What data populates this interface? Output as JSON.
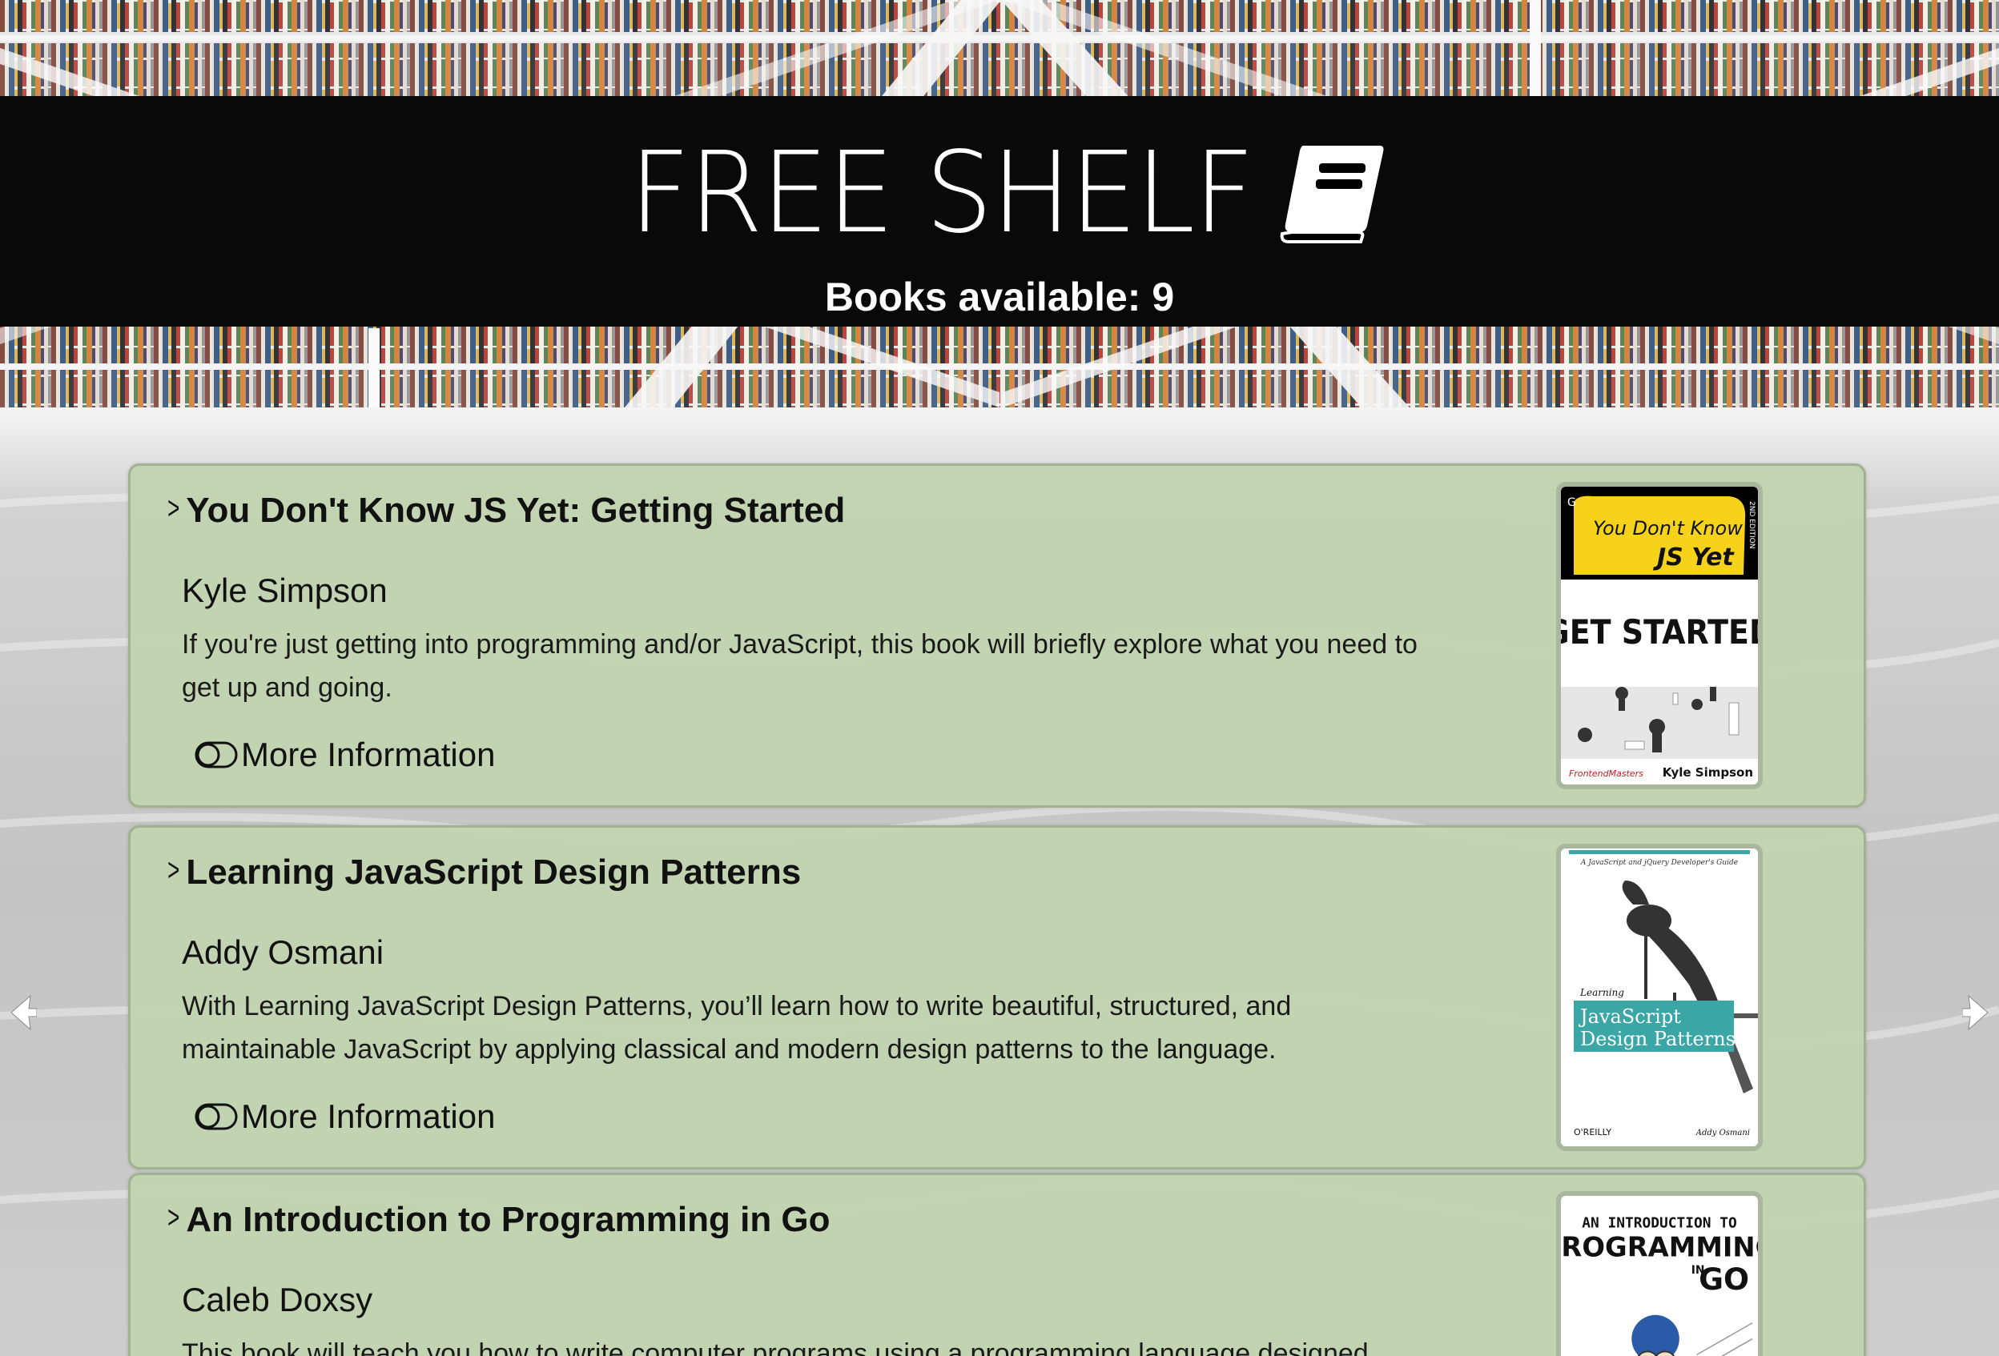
{
  "header": {
    "title": "FREE SHELF",
    "books_count": "Books available: 9"
  },
  "books": [
    {
      "title": "You Don't Know JS Yet: Getting Started",
      "author": "Kyle Simpson",
      "description": "If you're just getting into programming and/or JavaScript, this book will briefly explore what you need to get up and going.",
      "more_label": "More Information",
      "cover": {
        "line1": "You Don't Know",
        "line2": "JS Yet",
        "line3": "GET STARTED",
        "publisher": "FrontendMasters",
        "author": "Kyle Simpson",
        "edition": "2ND EDITION"
      }
    },
    {
      "title": "Learning JavaScript Design Patterns",
      "author": "Addy Osmani",
      "description": "With Learning JavaScript Design Patterns, you’ll learn how to write beautiful, structured, and maintainable JavaScript by applying classical and modern design patterns to the language.",
      "more_label": "More Information",
      "cover": {
        "tagline": "A JavaScript and jQuery Developer's Guide",
        "learning": "Learning",
        "line1": "JavaScript",
        "line2": "Design Patterns",
        "publisher": "O'REILLY",
        "author": "Addy Osmani"
      }
    },
    {
      "title": "An Introduction to Programming in Go",
      "author": "Caleb Doxsy",
      "description": "This book will teach you how to write computer programs using a programming language designed",
      "more_label": "More Information",
      "cover": {
        "line1": "AN INTRODUCTION TO",
        "line2": "PROGRAMMING",
        "line3": "IN",
        "line4": "GO"
      }
    }
  ],
  "colors": {
    "card_bg": "#c1d3b0",
    "card_border": "#9fb292",
    "band": "#000000",
    "cover_yellow": "#f6d21a",
    "cover_teal": "#3aa6a6"
  },
  "icons": {
    "logo": "book-icon",
    "chevron": "chevron-right-icon",
    "toggle": "toggle-icon",
    "prev": "chevron-left-icon",
    "next": "chevron-right-icon"
  }
}
